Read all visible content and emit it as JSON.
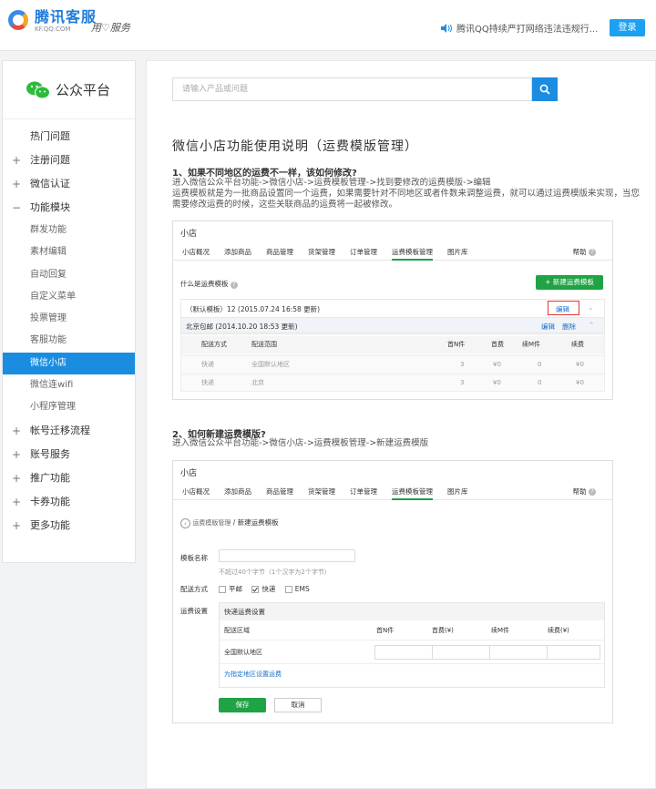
{
  "header": {
    "logo_title": "腾讯客服",
    "logo_domain": "KF.QQ.COM",
    "slogan": "用♡服务",
    "notice": "腾讯QQ持续严打网络违法违规行...",
    "login_label": "登录"
  },
  "sidebar": {
    "brand": "公众平台",
    "items": [
      {
        "label": "热门问题",
        "kind": "top",
        "marker": ""
      },
      {
        "label": "注册问题",
        "kind": "top",
        "marker": "+"
      },
      {
        "label": "微信认证",
        "kind": "top",
        "marker": "+"
      },
      {
        "label": "功能模块",
        "kind": "top",
        "marker": "−"
      },
      {
        "label": "群发功能",
        "kind": "sub"
      },
      {
        "label": "素材编辑",
        "kind": "sub"
      },
      {
        "label": "自动回复",
        "kind": "sub"
      },
      {
        "label": "自定义菜单",
        "kind": "sub"
      },
      {
        "label": "投票管理",
        "kind": "sub"
      },
      {
        "label": "客服功能",
        "kind": "sub"
      },
      {
        "label": "微信小店",
        "kind": "sub",
        "active": true
      },
      {
        "label": "微信连wifi",
        "kind": "sub"
      },
      {
        "label": "小程序管理",
        "kind": "sub"
      },
      {
        "label": "帐号迁移流程",
        "kind": "top",
        "marker": "+"
      },
      {
        "label": "账号服务",
        "kind": "top",
        "marker": "+"
      },
      {
        "label": "推广功能",
        "kind": "top",
        "marker": "+"
      },
      {
        "label": "卡券功能",
        "kind": "top",
        "marker": "+"
      },
      {
        "label": "更多功能",
        "kind": "top",
        "marker": "+"
      }
    ]
  },
  "search": {
    "placeholder": "请输入产品或问题"
  },
  "article": {
    "title": "微信小店功能使用说明（运费模版管理）",
    "q1": "1、如果不同地区的运费不一样，该如何修改?",
    "p1a": "进入微信公众平台功能->微信小店->运费模板管理->找到要修改的运费模版->编辑",
    "p1b": "运费模板就是为一批商品设置同一个运费，如果需要针对不同地区或者件数来调整运费，就可以通过运费模版来实现，当您需要修改运费的时候，这些关联商品的运费将一起被修改。",
    "q2": "2、如何新建运费模版?",
    "p2": "进入微信公众平台功能->微信小店->运费模板管理->新建运费模版"
  },
  "shop": {
    "title": "小店",
    "tabs": [
      "小店概况",
      "添加商品",
      "商品管理",
      "货架管理",
      "订单管理",
      "运费模板管理",
      "图片库"
    ],
    "help": "帮助"
  },
  "shot1": {
    "what_is": "什么是运费模板",
    "new_btn": "+ 新建运费模板",
    "tpl1": "（默认模板）12 (2015.07.24 16:58 更新)",
    "tpl1_edit": "编辑",
    "tpl2": "北京包邮 (2014.10.20 18:53 更新)",
    "tpl2_edit": "编辑",
    "tpl2_del": "删除",
    "headers": [
      "配送方式",
      "配送范围",
      "首N件",
      "首费",
      "续M件",
      "续费"
    ],
    "rows": [
      [
        "快递",
        "全国默认地区",
        "3",
        "¥0",
        "0",
        "¥0"
      ],
      [
        "快递",
        "北京",
        "3",
        "¥0",
        "0",
        "¥0"
      ]
    ]
  },
  "shot2": {
    "back": "运费模版管理",
    "crumb": "新建运费模板",
    "name_label": "模板名称",
    "name_hint": "不超过40个字节（1个汉字为2个字节）",
    "method_label": "配送方式",
    "methods": [
      "平邮",
      "快递",
      "EMS"
    ],
    "fee_label": "运费设置",
    "fee_box_title": "快递运费设置",
    "fee_headers": [
      "配送区域",
      "首N件",
      "首费(¥)",
      "续M件",
      "续费(¥)"
    ],
    "fee_row": "全国默认地区",
    "specify_link": "为指定地区设置运费",
    "save": "保存",
    "cancel": "取消"
  }
}
